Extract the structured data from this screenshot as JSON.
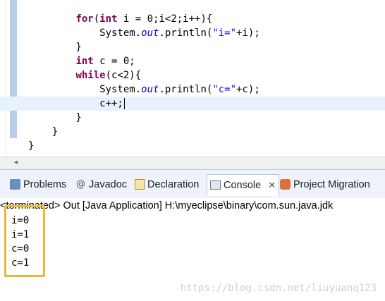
{
  "editor": {
    "lines": [
      [
        {
          "t": "        "
        },
        {
          "t": "for",
          "c": "kw"
        },
        {
          "t": "("
        },
        {
          "t": "int",
          "c": "kw"
        },
        {
          "t": " i = 0;i<2;i++){"
        }
      ],
      [
        {
          "t": "            System."
        },
        {
          "t": "out",
          "c": "it"
        },
        {
          "t": ".println("
        },
        {
          "t": "\"i=\"",
          "c": "st"
        },
        {
          "t": "+i);"
        }
      ],
      [
        {
          "t": "        }"
        }
      ],
      [
        {
          "t": "        "
        },
        {
          "t": "int",
          "c": "kw"
        },
        {
          "t": " c = 0;"
        }
      ],
      [
        {
          "t": "        "
        },
        {
          "t": "while",
          "c": "kw"
        },
        {
          "t": "(c<2){"
        }
      ],
      [
        {
          "t": "            System."
        },
        {
          "t": "out",
          "c": "it"
        },
        {
          "t": ".println("
        },
        {
          "t": "\"c=\"",
          "c": "st"
        },
        {
          "t": "+c);"
        }
      ],
      [
        {
          "t": "            c++;"
        },
        {
          "caret": true
        }
      ],
      [
        {
          "t": "        }"
        }
      ],
      [
        {
          "t": "    }"
        }
      ],
      [
        {
          "t": "}"
        }
      ]
    ],
    "current_line_index": 6
  },
  "tabs": [
    {
      "label": "Problems",
      "icon": "problems-icon",
      "active": false
    },
    {
      "label": "Javadoc",
      "icon": "javadoc-icon",
      "active": false
    },
    {
      "label": "Declaration",
      "icon": "declaration-icon",
      "active": false
    },
    {
      "label": "Console",
      "icon": "console-icon",
      "active": true
    },
    {
      "label": "Project Migration",
      "icon": "project-migration-icon",
      "active": false
    }
  ],
  "tab_javadoc_glyph": "@",
  "tab_close_glyph": "✕",
  "console": {
    "status": "<terminated> Out [Java Application] H:\\myeclipse\\binary\\com.sun.java.jdk",
    "output": [
      "i=0",
      "i=1",
      "c=0",
      "c=1"
    ]
  },
  "watermark": "https://blog.csdn.net/liuyuanq123",
  "colors": {
    "keyword": "#7f0055",
    "string": "#2a00ff",
    "field": "#0000c0",
    "highlight_border": "#f2b632"
  }
}
